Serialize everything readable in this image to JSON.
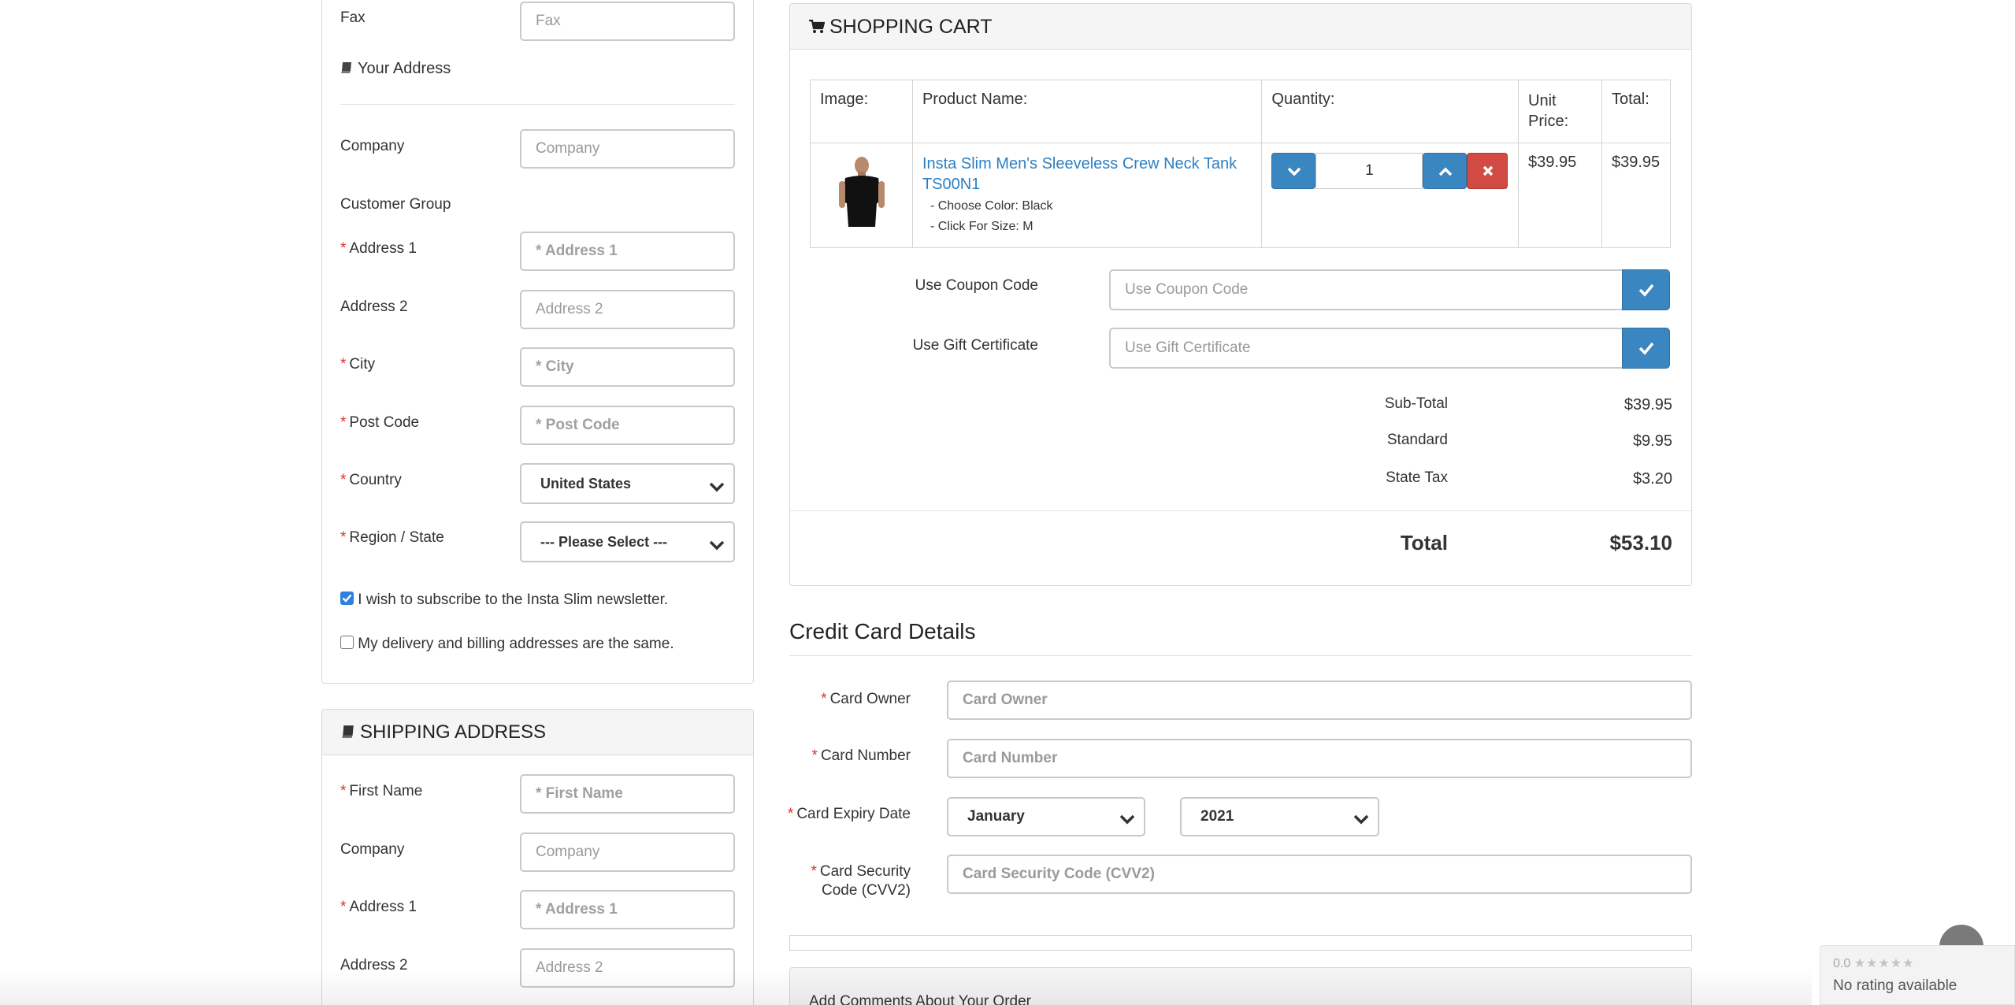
{
  "account": {
    "fax_label": "Fax",
    "fax_placeholder": "Fax",
    "section_title": "Your Address",
    "company_label": "Company",
    "company_placeholder": "Company",
    "customer_group_label": "Customer Group",
    "address1_label": "Address 1",
    "address1_placeholder": "* Address 1",
    "address2_label": "Address 2",
    "address2_placeholder": "Address 2",
    "city_label": "City",
    "city_placeholder": "* City",
    "postcode_label": "Post Code",
    "postcode_placeholder": "* Post Code",
    "country_label": "Country",
    "country_value": "United States",
    "region_label": "Region / State",
    "region_value": "--- Please Select ---",
    "newsletter_text": "I wish to subscribe to the Insta Slim newsletter.",
    "newsletter_checked": true,
    "same_address_text": "My delivery and billing addresses are the same.",
    "same_address_checked": false
  },
  "shipping": {
    "title": "SHIPPING ADDRESS",
    "firstname_label": "First Name",
    "firstname_placeholder": "* First Name",
    "company_label": "Company",
    "company_placeholder": "Company",
    "address1_label": "Address 1",
    "address1_placeholder": "* Address 1",
    "address2_label": "Address 2",
    "address2_placeholder": "Address 2"
  },
  "cart": {
    "title": "SHOPPING CART",
    "headers": {
      "image": "Image:",
      "product": "Product Name:",
      "quantity": "Quantity:",
      "unit_price_1": "Unit",
      "unit_price_2": "Price:",
      "total": "Total:"
    },
    "item": {
      "name": "Insta Slim Men's Sleeveless Crew Neck Tank TS00N1",
      "option_color": "- Choose Color: Black",
      "option_size": "- Click For Size: M",
      "quantity": "1",
      "unit_price": "$39.95",
      "total": "$39.95"
    },
    "coupon_label": "Use Coupon Code",
    "coupon_placeholder": "Use Coupon Code",
    "gift_label": "Use Gift Certificate",
    "gift_placeholder": "Use Gift Certificate",
    "totals": [
      {
        "label": "Sub-Total",
        "value": "$39.95"
      },
      {
        "label": "Standard",
        "value": "$9.95"
      },
      {
        "label": "State Tax",
        "value": "$3.20"
      }
    ],
    "grand_total_label": "Total",
    "grand_total_value": "$53.10"
  },
  "credit_card": {
    "title": "Credit Card Details",
    "owner_label": "Card Owner",
    "owner_placeholder": "Card Owner",
    "number_label": "Card Number",
    "number_placeholder": "Card Number",
    "expiry_label": "Card Expiry Date",
    "expiry_month": "January",
    "expiry_year": "2021",
    "cvv_label_1": "Card Security",
    "cvv_label_2": "Code (CVV2)",
    "cvv_placeholder": "Card Security Code (CVV2)"
  },
  "comments": {
    "title": "Add Comments About Your Order"
  },
  "rating_widget": {
    "score": "0.0",
    "text": "No rating available"
  },
  "colors": {
    "accent_blue": "#3a86c1",
    "link_blue": "#2d7fc2",
    "danger_red": "#d24a44",
    "required_red": "#d9342b"
  }
}
